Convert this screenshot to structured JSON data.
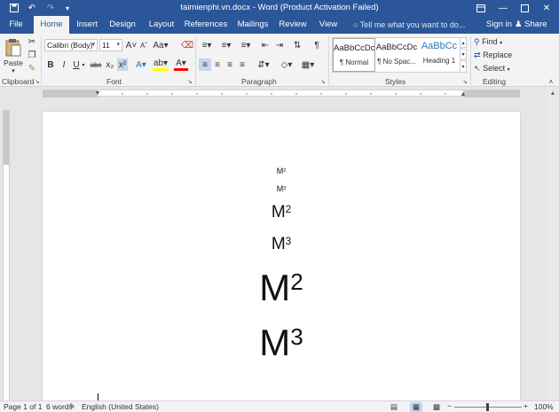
{
  "window": {
    "title": "taimienphi.vn.docx - Word (Product Activation Failed)"
  },
  "tabs": [
    "File",
    "Home",
    "Insert",
    "Design",
    "Layout",
    "References",
    "Mailings",
    "Review",
    "View"
  ],
  "tell_me": "Tell me what you want to do...",
  "account": {
    "sign_in": "Sign in",
    "share": "Share"
  },
  "clipboard": {
    "paste": "Paste",
    "label": "Clipboard"
  },
  "font": {
    "family": "Calibri (Body)",
    "size": "11",
    "label": "Font",
    "bold": "B",
    "italic": "I",
    "underline": "U",
    "strike": "abc",
    "subscript": "x₂",
    "superscript": "x²"
  },
  "paragraph": {
    "label": "Paragraph"
  },
  "styles": {
    "label": "Styles",
    "items": [
      {
        "preview": "AaBbCcDc",
        "name": "¶ Normal"
      },
      {
        "preview": "AaBbCcDc",
        "name": "¶ No Spac..."
      },
      {
        "preview": "AaBbCc",
        "name": "Heading 1"
      }
    ]
  },
  "editing": {
    "label": "Editing",
    "find": "Find",
    "replace": "Replace",
    "select": "Select"
  },
  "document": {
    "lines": [
      {
        "base": "M",
        "sup": "2"
      },
      {
        "base": "M",
        "sup": "3"
      },
      {
        "base": "M",
        "sup": "2"
      },
      {
        "base": "M",
        "sup": "3"
      },
      {
        "base": "M",
        "sup": "2"
      },
      {
        "base": "M",
        "sup": "3"
      }
    ]
  },
  "status": {
    "page": "Page 1 of 1",
    "words": "6 words",
    "language": "English (United States)",
    "zoom": "100%"
  },
  "colors": {
    "brand": "#2b579a",
    "highlight": "#ffff00",
    "font_color": "#ff0000"
  }
}
